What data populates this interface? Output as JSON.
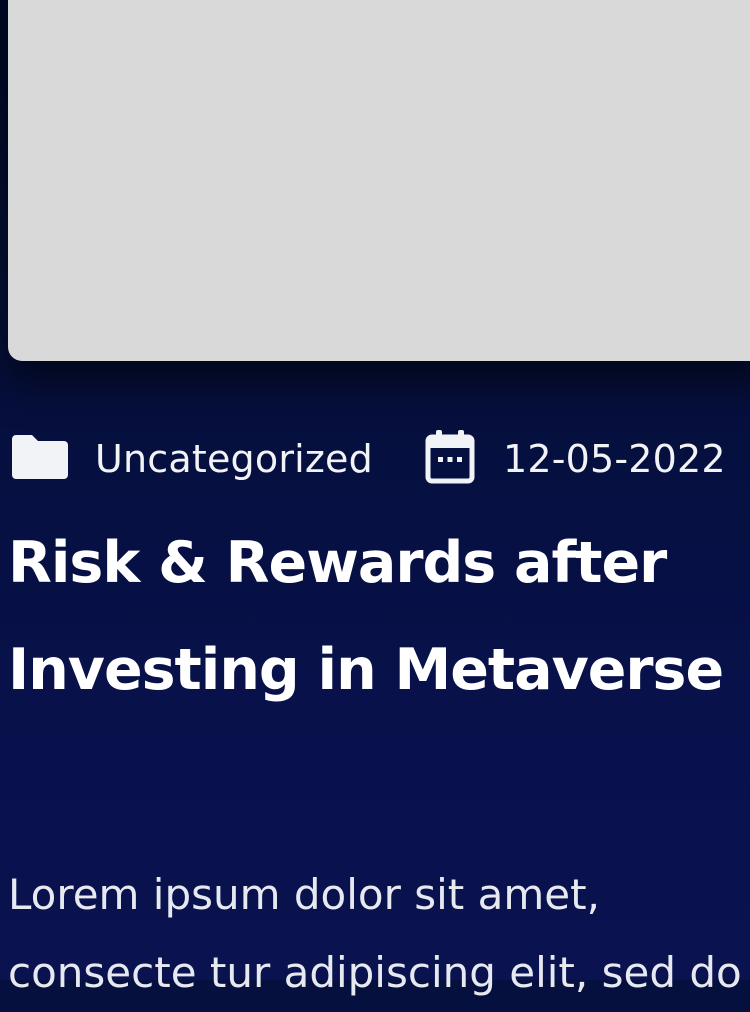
{
  "post": {
    "category": "Uncategorized",
    "date": "12-05-2022",
    "title": "Risk & Rewards after Investing in Metaverse",
    "excerpt_lines": [
      "Lorem ipsum dolor sit amet,",
      "consecte tur adipiscing elit, sed do"
    ]
  },
  "icons": {
    "category": "folder-icon",
    "date": "calendar-icon"
  },
  "colors": {
    "background": "#06103f",
    "text": "#ffffff",
    "image_placeholder": "#d9d9d9"
  }
}
